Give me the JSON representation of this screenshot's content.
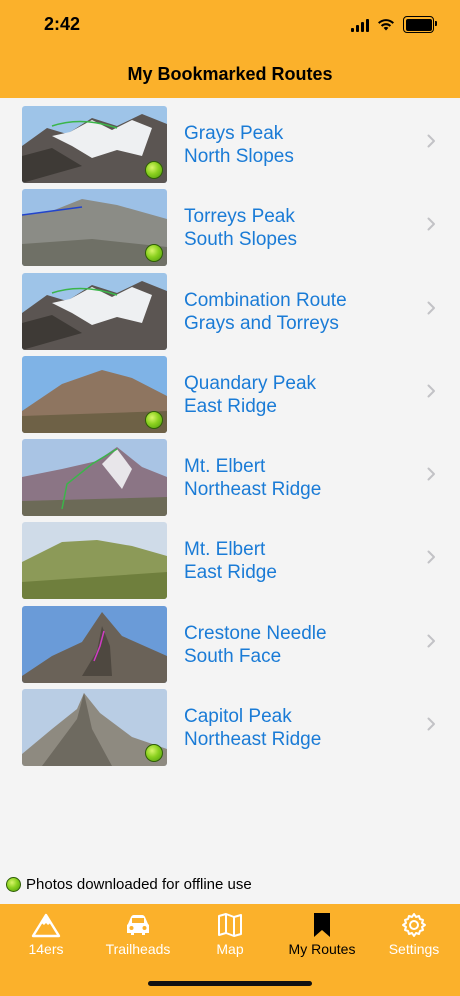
{
  "status_bar": {
    "time": "2:42"
  },
  "nav": {
    "title": "My Bookmarked Routes"
  },
  "routes": [
    {
      "line1": "Grays Peak",
      "line2": "North Slopes",
      "offline": true,
      "scene": "snowy"
    },
    {
      "line1": "Torreys Peak",
      "line2": "South Slopes",
      "offline": true,
      "scene": "grey"
    },
    {
      "line1": "Combination Route",
      "line2": "Grays and Torreys",
      "offline": false,
      "scene": "snowy"
    },
    {
      "line1": "Quandary Peak",
      "line2": "East Ridge",
      "offline": true,
      "scene": "dome"
    },
    {
      "line1": "Mt. Elbert",
      "line2": "Northeast Ridge",
      "offline": false,
      "scene": "purple"
    },
    {
      "line1": "Mt. Elbert",
      "line2": "East Ridge",
      "offline": false,
      "scene": "green"
    },
    {
      "line1": "Crestone Needle",
      "line2": "South Face",
      "offline": false,
      "scene": "needle"
    },
    {
      "line1": "Capitol Peak",
      "line2": "Northeast Ridge",
      "offline": true,
      "scene": "capitol"
    }
  ],
  "legend": {
    "text": "Photos downloaded for offline use"
  },
  "tabs": [
    {
      "label": "14ers",
      "icon": "mountain-icon",
      "active": false
    },
    {
      "label": "Trailheads",
      "icon": "car-icon",
      "active": false
    },
    {
      "label": "Map",
      "icon": "map-icon",
      "active": false
    },
    {
      "label": "My Routes",
      "icon": "bookmark-icon",
      "active": true
    },
    {
      "label": "Settings",
      "icon": "gear-icon",
      "active": false
    }
  ],
  "colors": {
    "accent": "#fbb12b",
    "link": "#1a7bd6",
    "offline_dot": "#8bd11f"
  }
}
